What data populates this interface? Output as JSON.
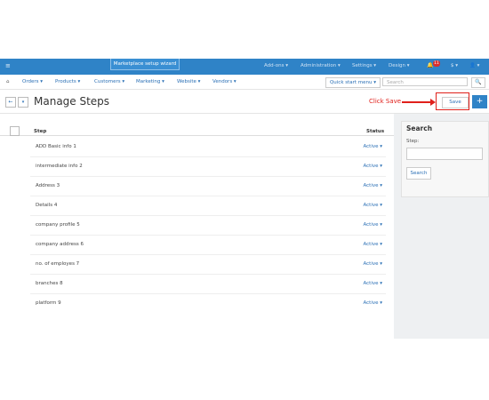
{
  "topbar": {
    "menu_icon": "≡",
    "wizard_label": "Marketplace setup wizard",
    "items": [
      "Add-ons ▾",
      "Administration ▾",
      "Settings ▾",
      "Design ▾"
    ],
    "badge": "11",
    "bell_icon": "🔔",
    "currency": "$ ▾",
    "user_icon": "👤 ▾"
  },
  "nav": {
    "home_icon": "⌂",
    "items": [
      "Orders ▾",
      "Products ▾",
      "Customers ▾",
      "Marketing ▾",
      "Website ▾",
      "Vendors ▾"
    ],
    "quick_start": "Quick start menu ▾",
    "search_placeholder": "Search",
    "search_icon": "🔍"
  },
  "titlebar": {
    "back_icon": "←",
    "dropdown_icon": "▾",
    "title": "Manage Steps",
    "annotation": "Click Save",
    "save_label": "Save",
    "plus_icon": "+"
  },
  "table": {
    "col_step": "Step",
    "col_status": "Status",
    "rows": [
      {
        "name": "ADD Basic info 1",
        "status": "Active ▾"
      },
      {
        "name": "intermediate info 2",
        "status": "Active ▾"
      },
      {
        "name": "Address 3",
        "status": "Active ▾"
      },
      {
        "name": "Details 4",
        "status": "Active ▾"
      },
      {
        "name": "company profile 5",
        "status": "Active ▾"
      },
      {
        "name": "company address 6",
        "status": "Active ▾"
      },
      {
        "name": "no. of employes 7",
        "status": "Active ▾"
      },
      {
        "name": "branches 8",
        "status": "Active ▾"
      },
      {
        "name": "platform 9",
        "status": "Active ▾"
      }
    ]
  },
  "sidebar": {
    "title": "Search",
    "step_label": "Step:",
    "button": "Search"
  },
  "colors": {
    "topbar": "#2f83c7",
    "link": "#2a6fb5",
    "annotation": "#e0201b"
  }
}
